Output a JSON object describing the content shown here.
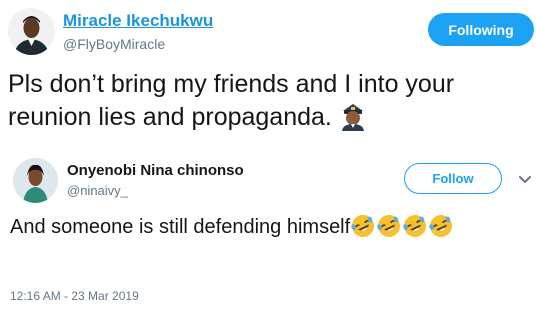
{
  "top_tweet": {
    "author_name": "Miracle Ikechukwu",
    "author_handle": "@FlyBoyMiracle",
    "follow_button": "Following",
    "text": "Pls don’t bring my friends and I into your reunion lies and propaganda.",
    "emoji_icon": "pilot-emoji-icon"
  },
  "reply_tweet": {
    "author_name": "Onyenobi Nina chinonso",
    "author_handle": "@ninaivy_",
    "follow_button": "Follow",
    "text": "And someone  is still defending himself",
    "emoji_icon": "rolling-laughing-emoji-icon",
    "emoji_count": 4,
    "timestamp": "12:16 AM - 23 Mar 2019"
  },
  "colors": {
    "link_blue": "#1b95e0",
    "button_blue": "#1da1f2",
    "secondary_text": "#657786",
    "emoji_yellow": "#f7c12e"
  }
}
